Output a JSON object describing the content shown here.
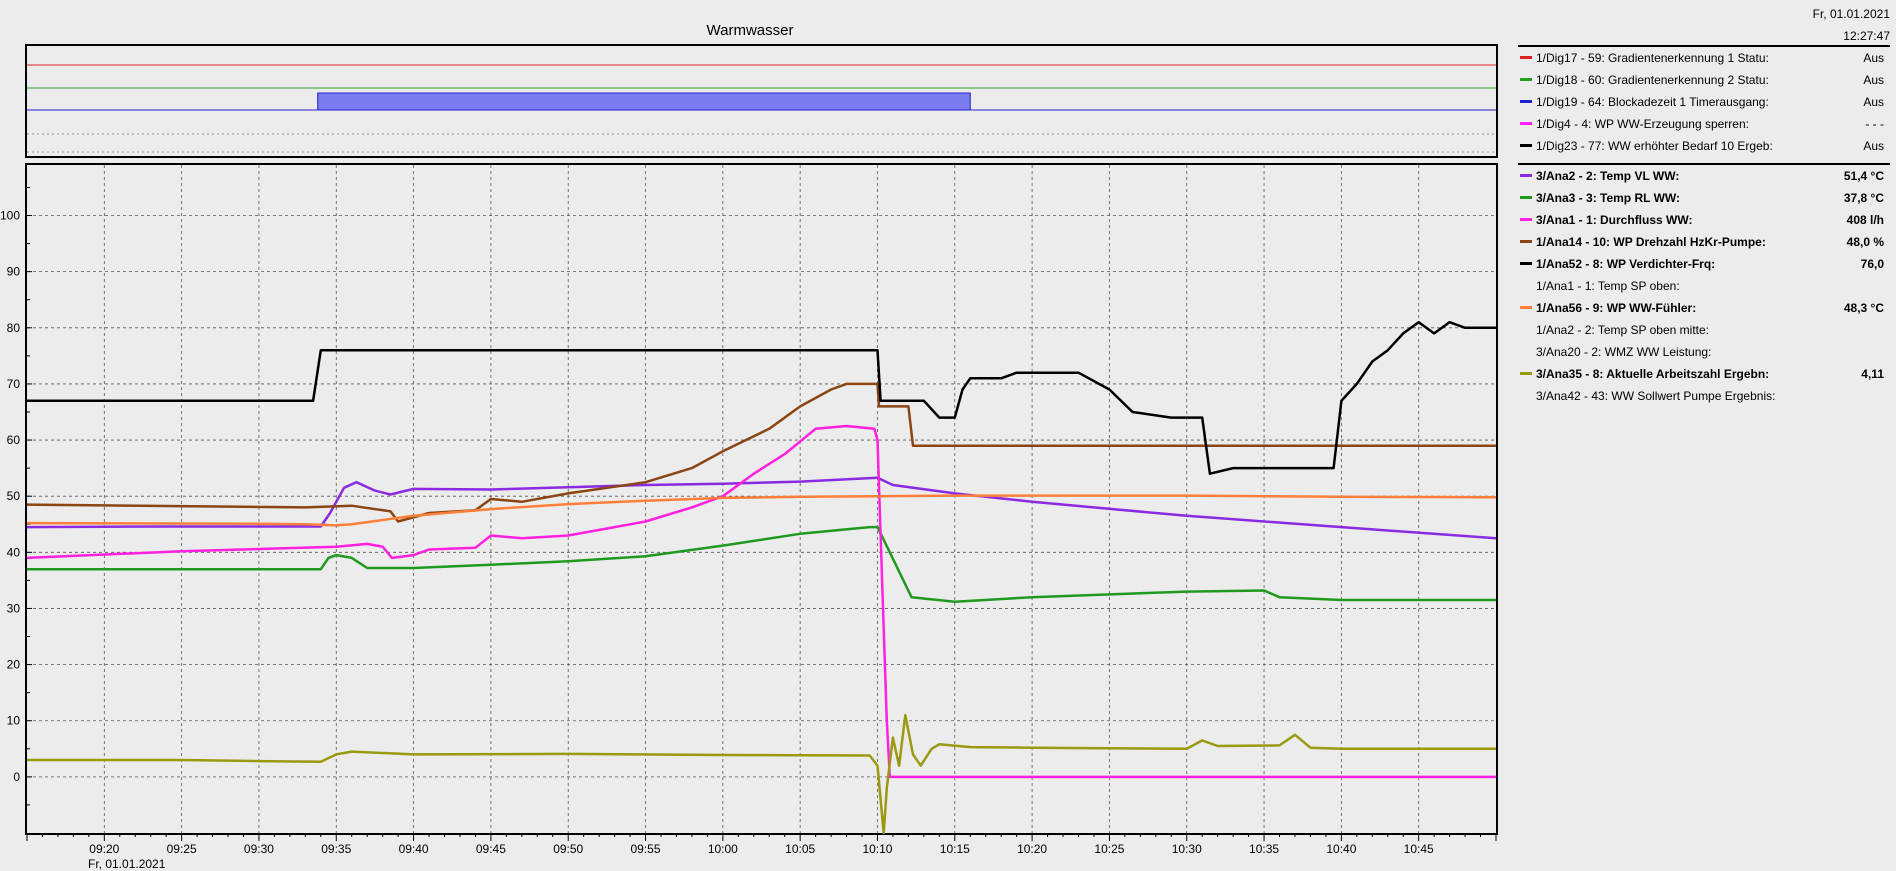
{
  "header": {
    "title": "Warmwasser",
    "date": "Fr, 01.01.2021",
    "time": "12:27:47",
    "axis_date": "Fr, 01.01.2021"
  },
  "chart_data": [
    {
      "type": "line",
      "panel": "digital",
      "xlabel": "",
      "ylabel": "",
      "series": [
        {
          "name": "1/Dig17 - 59: Gradientenerkennung 1 Statu:",
          "color": "#e02020",
          "segments": [
            {
              "from": "09:15",
              "to": "10:50",
              "value": 0
            }
          ]
        },
        {
          "name": "1/Dig18 - 60: Gradientenerkennung 2 Statu:",
          "color": "#20a020",
          "segments": [
            {
              "from": "09:15",
              "to": "10:50",
              "value": 0
            }
          ]
        },
        {
          "name": "1/Dig19 - 64: Blockadezeit 1 Timerausgang:",
          "color": "#2020d0",
          "fill": "#7b7bf0",
          "segments": [
            {
              "from": "09:15",
              "to": "09:33.8",
              "value": 0
            },
            {
              "from": "09:33.8",
              "to": "10:16",
              "value": 1
            },
            {
              "from": "10:16",
              "to": "10:50",
              "value": 0
            }
          ]
        },
        {
          "name": "1/Dig4 - 4: WP WW-Erzeugung sperren:",
          "color": "#ff20ff",
          "segments": []
        },
        {
          "name": "1/Dig23 - 77: WW erhöhter Bedarf 10 Ergeb:",
          "color": "#000000",
          "segments": []
        }
      ]
    },
    {
      "type": "line",
      "panel": "analog",
      "xlabel": "",
      "ylabel": "",
      "x_ticks": [
        "09:20",
        "09:25",
        "09:30",
        "09:35",
        "09:40",
        "09:45",
        "09:50",
        "09:55",
        "10:00",
        "10:05",
        "10:10",
        "10:15",
        "10:20",
        "10:25",
        "10:30",
        "10:35",
        "10:40",
        "10:45"
      ],
      "xlim": [
        "09:15",
        "10:50"
      ],
      "y_ticks": [
        0,
        10,
        20,
        30,
        40,
        50,
        60,
        70,
        80,
        90,
        100
      ],
      "ylim": [
        -10,
        109
      ],
      "grid": true,
      "series": [
        {
          "name": "3/Ana2 - 2: Temp VL WW:",
          "color": "#8a2be2",
          "points": [
            [
              "09:15",
              44.5
            ],
            [
              "09:24",
              44.6
            ],
            [
              "09:34",
              44.6
            ],
            [
              "09:34.6",
              47
            ],
            [
              "09:35.5",
              51.5
            ],
            [
              "09:36.3",
              52.5
            ],
            [
              "09:37.5",
              51
            ],
            [
              "09:38.5",
              50.3
            ],
            [
              "09:40",
              51.3
            ],
            [
              "09:45",
              51.2
            ],
            [
              "09:50",
              51.6
            ],
            [
              "09:55",
              52
            ],
            [
              "10:00",
              52.2
            ],
            [
              "10:05",
              52.6
            ],
            [
              "10:10",
              53.3
            ],
            [
              "10:11",
              52
            ],
            [
              "10:15",
              50.5
            ],
            [
              "10:20",
              49
            ],
            [
              "10:30",
              46.5
            ],
            [
              "10:40",
              44.5
            ],
            [
              "10:50",
              42.5
            ]
          ]
        },
        {
          "name": "3/Ana3 - 3: Temp RL WW:",
          "color": "#1f9a1f",
          "points": [
            [
              "09:15",
              37
            ],
            [
              "09:34",
              37
            ],
            [
              "09:34.5",
              39
            ],
            [
              "09:35",
              39.5
            ],
            [
              "09:36",
              39
            ],
            [
              "09:37",
              37.2
            ],
            [
              "09:40",
              37.2
            ],
            [
              "09:45",
              37.8
            ],
            [
              "09:50",
              38.4
            ],
            [
              "09:55",
              39.3
            ],
            [
              "10:00",
              41.2
            ],
            [
              "10:05",
              43.3
            ],
            [
              "10:09.5",
              44.5
            ],
            [
              "10:10",
              44.5
            ],
            [
              "10:10.8",
              40
            ],
            [
              "10:11.5",
              36
            ],
            [
              "10:12.2",
              32
            ],
            [
              "10:15",
              31.2
            ],
            [
              "10:20",
              32
            ],
            [
              "10:30",
              33
            ],
            [
              "10:35",
              33.2
            ],
            [
              "10:36",
              32
            ],
            [
              "10:40",
              31.5
            ],
            [
              "10:50",
              31.5
            ]
          ]
        },
        {
          "name": "3/Ana1 - 1: Durchfluss WW:",
          "color": "#ff20e0",
          "points": [
            [
              "09:15",
              39
            ],
            [
              "09:25",
              40.2
            ],
            [
              "09:35",
              41
            ],
            [
              "09:37",
              41.5
            ],
            [
              "09:38",
              41
            ],
            [
              "09:38.6",
              39
            ],
            [
              "09:40",
              39.5
            ],
            [
              "09:41",
              40.5
            ],
            [
              "09:44",
              40.8
            ],
            [
              "09:45",
              43
            ],
            [
              "09:47",
              42.5
            ],
            [
              "09:50",
              43
            ],
            [
              "09:53",
              44.5
            ],
            [
              "09:55",
              45.5
            ],
            [
              "09:58",
              48
            ],
            [
              "10:00",
              50
            ],
            [
              "10:02",
              54
            ],
            [
              "10:04",
              57.5
            ],
            [
              "10:06",
              62
            ],
            [
              "10:08",
              62.5
            ],
            [
              "10:09.8",
              62
            ],
            [
              "10:10",
              60
            ],
            [
              "10:10.3",
              35
            ],
            [
              "10:10.6",
              10
            ],
            [
              "10:10.8",
              0
            ],
            [
              "10:50",
              0
            ]
          ]
        },
        {
          "name": "1/Ana14 - 10: WP Drehzahl HzKr-Pumpe:",
          "color": "#8b4513",
          "points": [
            [
              "09:15",
              48.5
            ],
            [
              "09:33",
              48
            ],
            [
              "09:36",
              48.3
            ],
            [
              "09:38.5",
              47.3
            ],
            [
              "09:39",
              45.5
            ],
            [
              "09:41",
              47
            ],
            [
              "09:44",
              47.5
            ],
            [
              "09:45",
              49.5
            ],
            [
              "09:47",
              49
            ],
            [
              "09:50",
              50.5
            ],
            [
              "09:55",
              52.5
            ],
            [
              "09:58",
              55
            ],
            [
              "10:00",
              58
            ],
            [
              "10:03",
              62
            ],
            [
              "10:05",
              66
            ],
            [
              "10:07",
              69
            ],
            [
              "10:08",
              70
            ],
            [
              "10:10",
              70
            ],
            [
              "10:10.1",
              66
            ],
            [
              "10:12",
              66
            ],
            [
              "10:12.3",
              59
            ],
            [
              "10:50",
              59
            ]
          ]
        },
        {
          "name": "1/Ana52 - 8: WP Verdichter-Frq:",
          "color": "#000000",
          "points": [
            [
              "09:15",
              67
            ],
            [
              "09:33.5",
              67
            ],
            [
              "09:34",
              76
            ],
            [
              "10:10",
              76
            ],
            [
              "10:10.2",
              67
            ],
            [
              "10:13",
              67
            ],
            [
              "10:14",
              64
            ],
            [
              "10:15",
              64
            ],
            [
              "10:15.5",
              69
            ],
            [
              "10:16",
              71
            ],
            [
              "10:18",
              71
            ],
            [
              "10:19",
              72
            ],
            [
              "10:23",
              72
            ],
            [
              "10:25",
              69
            ],
            [
              "10:26.5",
              65
            ],
            [
              "10:29",
              64
            ],
            [
              "10:31",
              64
            ],
            [
              "10:31.5",
              54
            ],
            [
              "10:33",
              55
            ],
            [
              "10:38",
              55
            ],
            [
              "10:39.5",
              55
            ],
            [
              "10:40",
              67
            ],
            [
              "10:41",
              70
            ],
            [
              "10:42",
              74
            ],
            [
              "10:43",
              76
            ],
            [
              "10:44",
              79
            ],
            [
              "10:45",
              81
            ],
            [
              "10:46",
              79
            ],
            [
              "10:47",
              81
            ],
            [
              "10:48",
              80
            ],
            [
              "10:50",
              80
            ]
          ]
        },
        {
          "name": "1/Ana1 - 1: Temp SP oben:",
          "color": "",
          "points": []
        },
        {
          "name": "1/Ana56 - 9: WP WW-Fühler:",
          "color": "#ff7f3a",
          "points": [
            [
              "09:15",
              45.2
            ],
            [
              "09:30",
              45.1
            ],
            [
              "09:33",
              45
            ],
            [
              "09:35",
              44.8
            ],
            [
              "09:36",
              45
            ],
            [
              "09:40",
              46.5
            ],
            [
              "09:45",
              47.7
            ],
            [
              "09:50",
              48.6
            ],
            [
              "09:55",
              49.2
            ],
            [
              "10:00",
              49.7
            ],
            [
              "10:05",
              49.9
            ],
            [
              "10:10",
              50
            ],
            [
              "10:15",
              50.1
            ],
            [
              "10:30",
              50.1
            ],
            [
              "10:40",
              49.9
            ],
            [
              "10:50",
              49.8
            ]
          ]
        },
        {
          "name": "1/Ana2 - 2: Temp SP oben mitte:",
          "color": "",
          "points": []
        },
        {
          "name": "3/Ana20 - 2: WMZ WW Leistung:",
          "color": "",
          "points": []
        },
        {
          "name": "3/Ana35 - 8: Aktuelle Arbeitszahl Ergebn:",
          "color": "#9a9a10",
          "points": [
            [
              "09:15",
              3
            ],
            [
              "09:25",
              3
            ],
            [
              "09:30",
              2.8
            ],
            [
              "09:34",
              2.7
            ],
            [
              "09:35",
              4
            ],
            [
              "09:36",
              4.5
            ],
            [
              "09:40",
              4
            ],
            [
              "09:50",
              4.1
            ],
            [
              "10:00",
              3.9
            ],
            [
              "10:09.5",
              3.8
            ],
            [
              "10:10",
              2
            ],
            [
              "10:10.4",
              -10
            ],
            [
              "10:10.6",
              -2
            ],
            [
              "10:11",
              7
            ],
            [
              "10:11.4",
              2
            ],
            [
              "10:11.8",
              11
            ],
            [
              "10:12.3",
              4
            ],
            [
              "10:12.8",
              2
            ],
            [
              "10:13.5",
              5
            ],
            [
              "10:14",
              5.8
            ],
            [
              "10:16",
              5.3
            ],
            [
              "10:20",
              5.2
            ],
            [
              "10:30",
              5
            ],
            [
              "10:31",
              6.5
            ],
            [
              "10:32",
              5.5
            ],
            [
              "10:36",
              5.6
            ],
            [
              "10:37",
              7.5
            ],
            [
              "10:38",
              5.2
            ],
            [
              "10:40",
              5
            ],
            [
              "10:50",
              5
            ]
          ]
        },
        {
          "name": "3/Ana42 - 43: WW Sollwert Pumpe Ergebnis:",
          "color": "",
          "points": []
        }
      ]
    }
  ],
  "legend_digital": [
    {
      "label": "1/Dig17 - 59: Gradientenerkennung 1 Statu:",
      "value": "Aus",
      "color": "#e02020",
      "bold": false
    },
    {
      "label": "1/Dig18 - 60: Gradientenerkennung 2 Statu:",
      "value": "Aus",
      "color": "#20a020",
      "bold": false
    },
    {
      "label": "1/Dig19 - 64: Blockadezeit 1 Timerausgang:",
      "value": "Aus",
      "color": "#2020d0",
      "bold": false
    },
    {
      "label": "1/Dig4 - 4: WP WW-Erzeugung sperren:",
      "value": "- - -",
      "color": "#ff20ff",
      "bold": false
    },
    {
      "label": "1/Dig23 - 77: WW erhöhter Bedarf 10 Ergeb:",
      "value": "Aus",
      "color": "#000000",
      "bold": false
    }
  ],
  "legend_analog": [
    {
      "label": "3/Ana2 - 2: Temp VL WW:",
      "value": "51,4 °C",
      "color": "#8a2be2",
      "bold": true
    },
    {
      "label": "3/Ana3 - 3: Temp RL WW:",
      "value": "37,8 °C",
      "color": "#1f9a1f",
      "bold": true
    },
    {
      "label": "3/Ana1 - 1: Durchfluss WW:",
      "value": "408 l/h",
      "color": "#ff20e0",
      "bold": true
    },
    {
      "label": "1/Ana14 - 10: WP Drehzahl HzKr-Pumpe:",
      "value": "48,0 %",
      "color": "#8b4513",
      "bold": true
    },
    {
      "label": "1/Ana52 - 8: WP Verdichter-Frq:",
      "value": "76,0",
      "color": "#000000",
      "bold": true
    },
    {
      "label": "1/Ana1 - 1: Temp SP oben:",
      "value": "",
      "color": "",
      "bold": false
    },
    {
      "label": "1/Ana56 - 9: WP WW-Fühler:",
      "value": "48,3 °C",
      "color": "#ff7f3a",
      "bold": true
    },
    {
      "label": "1/Ana2 - 2: Temp SP oben mitte:",
      "value": "",
      "color": "",
      "bold": false
    },
    {
      "label": "3/Ana20 - 2: WMZ WW Leistung:",
      "value": "",
      "color": "",
      "bold": false
    },
    {
      "label": "3/Ana35 - 8: Aktuelle Arbeitszahl Ergebn:",
      "value": "4,11",
      "color": "#9a9a10",
      "bold": true
    },
    {
      "label": "3/Ana42 - 43: WW Sollwert Pumpe Ergebnis:",
      "value": "",
      "color": "",
      "bold": false
    }
  ]
}
